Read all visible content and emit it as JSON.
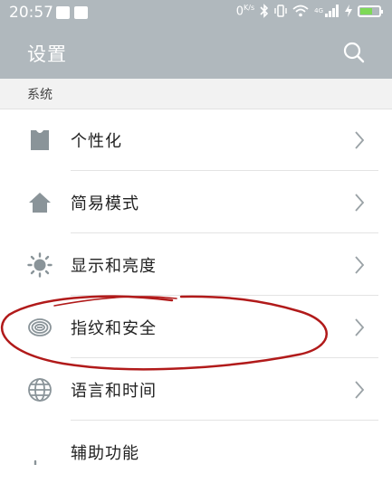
{
  "status": {
    "time": "20:57",
    "speed": "0",
    "speed_unit": "K/s",
    "net_badge": "4G",
    "left_icons": [
      "message-icon",
      "notification-icon"
    ],
    "right_icons": [
      "bluetooth-icon",
      "vibrate-icon",
      "wifi-icon",
      "signal-icon",
      "charging-icon",
      "battery-icon"
    ]
  },
  "header": {
    "title": "设置"
  },
  "section": {
    "label": "系统"
  },
  "items": [
    {
      "label": "个性化",
      "icon": "shirt-icon"
    },
    {
      "label": "简易模式",
      "icon": "home-icon"
    },
    {
      "label": "显示和亮度",
      "icon": "brightness-icon"
    },
    {
      "label": "指纹和安全",
      "icon": "fingerprint-icon"
    },
    {
      "label": "语言和时间",
      "icon": "globe-icon"
    },
    {
      "label": "辅助功能",
      "icon": "accessibility-icon"
    }
  ],
  "colors": {
    "header_bg": "#b0b8bd",
    "icon": "#8a9499",
    "annotation": "#b11a1a"
  }
}
